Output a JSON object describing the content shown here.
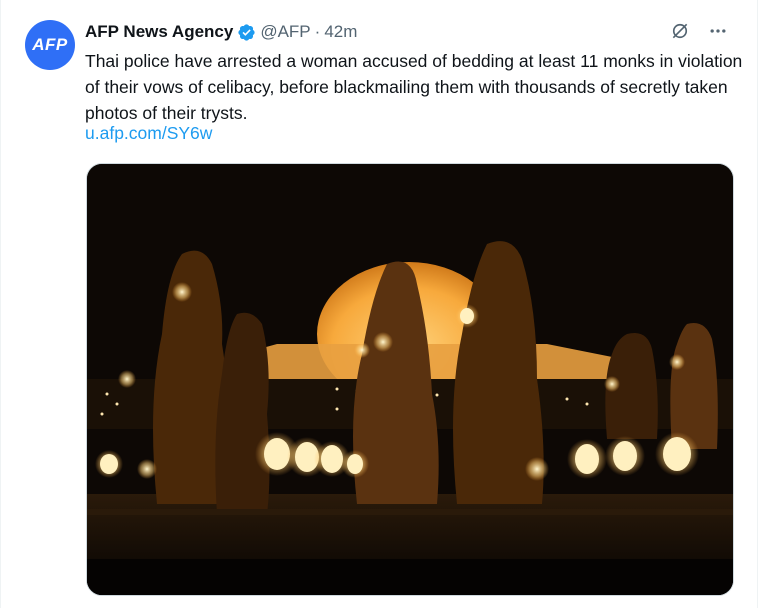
{
  "tweet": {
    "avatar_text": "AFP",
    "author_name": "AFP News Agency",
    "handle": "@AFP",
    "separator": "·",
    "time": "42m",
    "text": "Thai police have arrested a woman accused of bedding at least 11 monks in violation of their vows of celibacy, before blackmailing them with thousands of secretly taken photos of their trysts.",
    "link": "u.afp.com/SY6w",
    "verified_icon": "verified-badge-icon",
    "grok_icon": "grok-icon",
    "more_icon": "more-icon"
  },
  "colors": {
    "link": "#1d9bf0",
    "verified": "#1d9bf0",
    "avatar_bg": "#2f6ff6",
    "secondary": "#536471"
  }
}
